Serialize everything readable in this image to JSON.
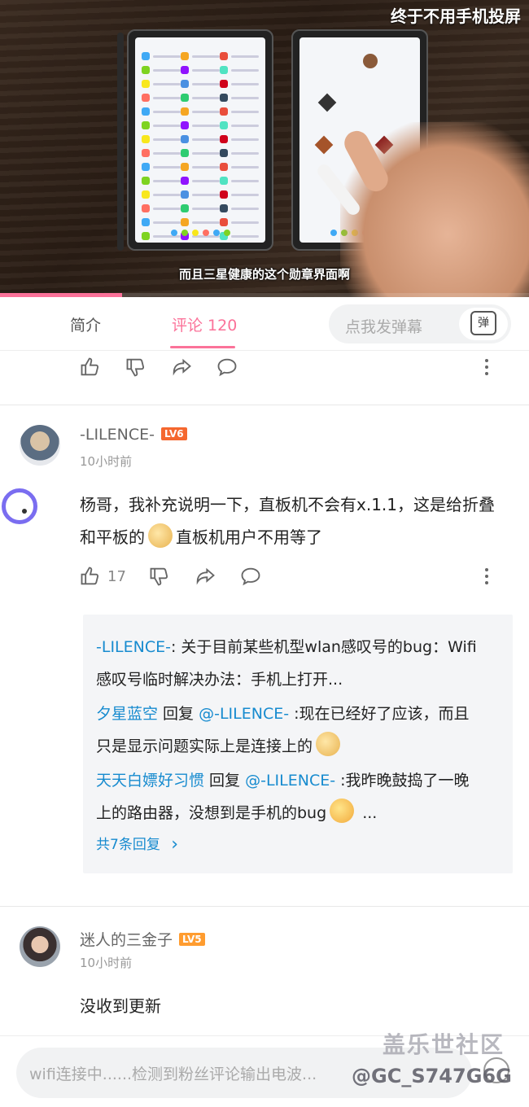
{
  "video": {
    "title_overlay": "终于不用手机投屏",
    "subtitle": "而且三星健康的这个勋章界面啊",
    "progress": 0.23
  },
  "tabs": {
    "intro": "简介",
    "comments": "评论 120",
    "danmaku_placeholder": "点我发弹幕",
    "danmaku_button": "弹"
  },
  "comments": [
    {
      "username": "-LILENCE-",
      "level": "LV6",
      "time": "10小时前",
      "text_a": "杨哥，我补充说明一下，直板机不会有x.1.1，这是给折叠和平板的",
      "text_b": "直板机用户不用等了",
      "likes": "17",
      "replies": [
        {
          "author": "-LILENCE-",
          "sep": ":",
          "body": " 关于目前某些机型wlan感叹号的bug：Wifi感叹号临时解决办法：手机上打开..."
        },
        {
          "author": "夕星蓝空",
          "mid": " 回复 ",
          "mention": "@-LILENCE-",
          "body": " :现在已经好了应该，而且只是显示问题实际上是连接上的"
        },
        {
          "author": "天天白嫖好习惯",
          "mid": " 回复 ",
          "mention": "@-LILENCE-",
          "body": " :我昨晚鼓捣了一晚上的路由器，没想到是手机的bug",
          "tail": " ..."
        }
      ],
      "all_replies": "共7条回复",
      "all_replies_arrow": "›"
    },
    {
      "username": "迷人的三金子",
      "level": "LV5",
      "time": "10小时前",
      "text": "没收到更新"
    }
  ],
  "bottom": {
    "input_placeholder": "wifi连接中......检测到粉丝评论输出电波..."
  },
  "watermark": {
    "line1": "盖乐世社区",
    "line2": "@GC_S747G6G"
  },
  "colors": {
    "accent": "#fb7299",
    "link": "#178bcf"
  },
  "icons": [
    "like-icon",
    "dislike-icon",
    "share-icon",
    "comment-icon",
    "more-icon",
    "danmaku-tv-icon",
    "emoji-icon",
    "chevron-right-icon"
  ]
}
